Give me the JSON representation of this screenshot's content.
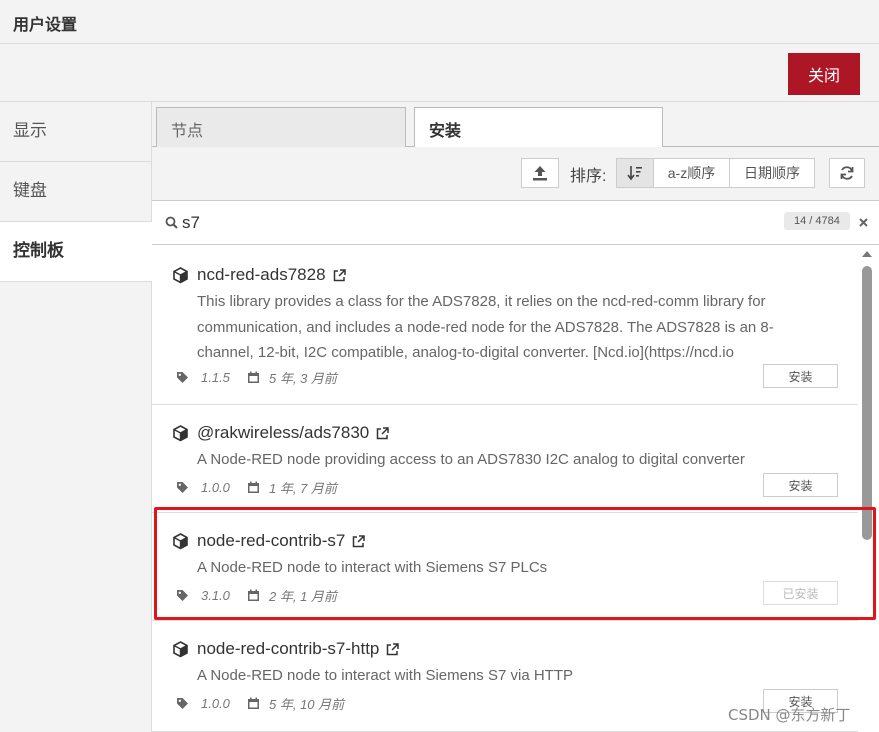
{
  "dialog": {
    "title": "用户设置",
    "close_label": "关闭"
  },
  "sidebar": {
    "items": [
      {
        "label": "显示"
      },
      {
        "label": "键盘"
      },
      {
        "label": "控制板",
        "active": true
      }
    ]
  },
  "tabs": [
    {
      "label": "节点"
    },
    {
      "label": "安装",
      "active": true
    }
  ],
  "toolbar": {
    "sort_label": "排序:",
    "sort_az": "a-z顺序",
    "sort_date": "日期顺序"
  },
  "search": {
    "value": "s7",
    "count": "14 / 4784"
  },
  "packages": [
    {
      "name": "ncd-red-ads7828",
      "description": "This library provides a class for the ADS7828, it relies on the ncd-red-comm library for communication, and includes a node-red node for the ADS7828. The ADS7828 is an 8-channel, 12-bit, I2C compatible, analog-to-digital converter. [Ncd.io](https://ncd.io",
      "version": "1.1.5",
      "updated": "5 年, 3 月前",
      "button": "安装",
      "installed": false
    },
    {
      "name": "@rakwireless/ads7830",
      "description": "A Node-RED node providing access to an ADS7830 I2C analog to digital converter",
      "version": "1.0.0",
      "updated": "1 年, 7 月前",
      "button": "安装",
      "installed": false
    },
    {
      "name": "node-red-contrib-s7",
      "description": "A Node-RED node to interact with Siemens S7 PLCs",
      "version": "3.1.0",
      "updated": "2 年, 1 月前",
      "button": "已安装",
      "installed": true
    },
    {
      "name": "node-red-contrib-s7-http",
      "description": "A Node-RED node to interact with Siemens S7 via HTTP",
      "version": "1.0.0",
      "updated": "5 年, 10 月前",
      "button": "安装",
      "installed": false
    }
  ],
  "watermark": "CSDN @东方新丁",
  "colors": {
    "accent": "#ad1625",
    "highlight": "#e0151c"
  }
}
